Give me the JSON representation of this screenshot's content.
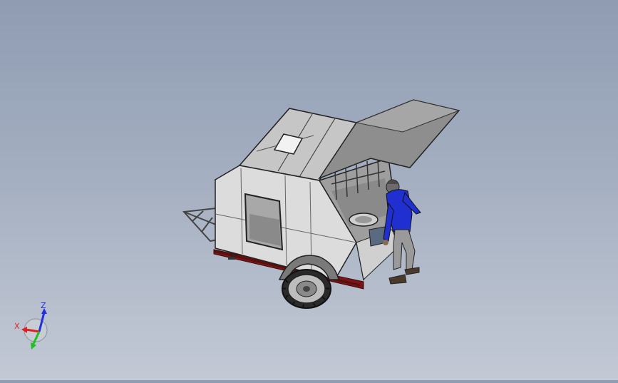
{
  "viewport": {
    "background_top": "#8f9cb2",
    "background_bottom": "#c3c9d5"
  },
  "model": {
    "body_color": "#d9d9d9",
    "frame_color": "#7a1515",
    "person_shirt_color": "#1f2fd0",
    "person_pants_color": "#9a9a9a"
  },
  "triad": {
    "x_label": "X",
    "z_label": "Z",
    "x_color": "#e02020",
    "y_color": "#20c020",
    "z_color": "#2030e0"
  }
}
